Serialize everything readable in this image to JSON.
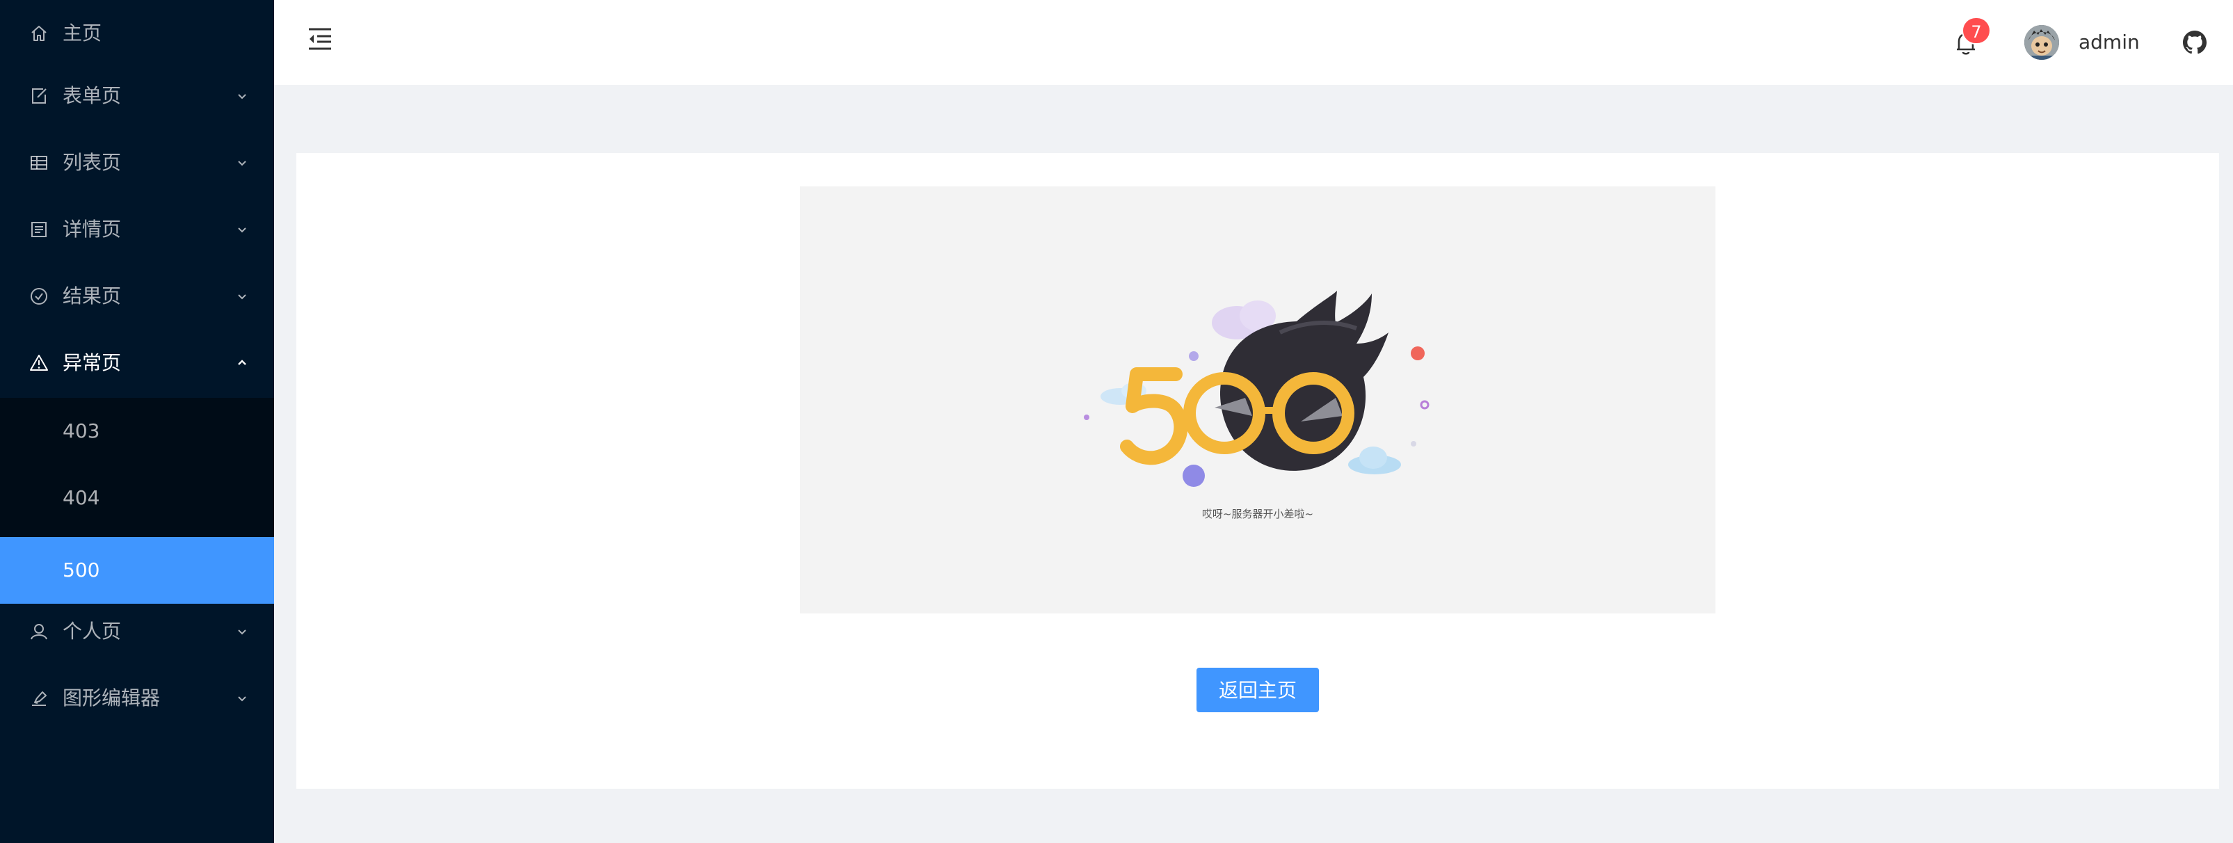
{
  "sidebar": {
    "items": [
      {
        "label": "主页",
        "icon": "home-icon",
        "has_arrow": false
      },
      {
        "label": "表单页",
        "icon": "form-edit-icon",
        "has_arrow": true
      },
      {
        "label": "列表页",
        "icon": "table-icon",
        "has_arrow": true
      },
      {
        "label": "详情页",
        "icon": "profile-icon",
        "has_arrow": true
      },
      {
        "label": "结果页",
        "icon": "check-circle-icon",
        "has_arrow": true
      },
      {
        "label": "异常页",
        "icon": "warning-icon",
        "has_arrow": true,
        "open": true
      },
      {
        "label": "个人页",
        "icon": "user-icon",
        "has_arrow": true
      },
      {
        "label": "图形编辑器",
        "icon": "highlight-icon",
        "has_arrow": true
      }
    ],
    "exception_submenu": [
      {
        "label": "403",
        "active": false
      },
      {
        "label": "404",
        "active": false
      },
      {
        "label": "500",
        "active": true
      }
    ]
  },
  "header": {
    "notification_count": "7",
    "username": "admin"
  },
  "main": {
    "illustration_text": "500",
    "illustration_caption": "哎呀~服务器开小差啦~",
    "back_button_label": "返回主页"
  },
  "colors": {
    "sidebar_bg": "#001529",
    "submenu_bg": "#000c17",
    "primary": "#4096ff",
    "badge": "#ff4d4f",
    "content_bg": "#f0f2f5"
  }
}
